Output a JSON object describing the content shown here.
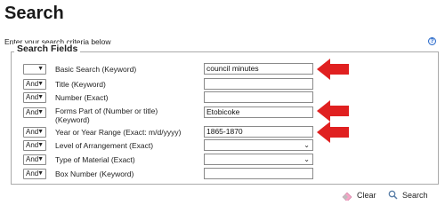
{
  "page": {
    "title": "Search",
    "hint": "Enter your search criteria below",
    "help_icon_glyph": "?"
  },
  "fieldset": {
    "legend": "Search Fields"
  },
  "colors": {
    "arrow": "#e02020",
    "help": "#2a6ac8"
  },
  "rows": [
    {
      "operator": "",
      "label": "Basic Search  (Keyword)",
      "value": "council minutes",
      "type": "text",
      "highlighted": true
    },
    {
      "operator": "And",
      "label": "Title  (Keyword)",
      "value": "",
      "type": "text",
      "highlighted": false
    },
    {
      "operator": "And",
      "label": "Number  (Exact)",
      "value": "",
      "type": "text",
      "highlighted": false
    },
    {
      "operator": "And",
      "label": "Forms Part of (Number or title)",
      "label_line2": "(Keyword)",
      "value": "Etobicoke",
      "type": "text",
      "highlighted": true
    },
    {
      "operator": "And",
      "label": "Year or Year Range  (Exact: m/d/yyyy)",
      "value": "1865-1870",
      "type": "text",
      "highlighted": true
    },
    {
      "operator": "And",
      "label": "Level of Arrangement  (Exact)",
      "value": "",
      "type": "select",
      "highlighted": false
    },
    {
      "operator": "And",
      "label": "Type of Material  (Exact)",
      "value": "",
      "type": "select",
      "highlighted": false
    },
    {
      "operator": "And",
      "label": "Box Number  (Keyword)",
      "value": "",
      "type": "text",
      "highlighted": false
    }
  ],
  "actions": {
    "clear_label": "Clear",
    "search_label": "Search"
  }
}
